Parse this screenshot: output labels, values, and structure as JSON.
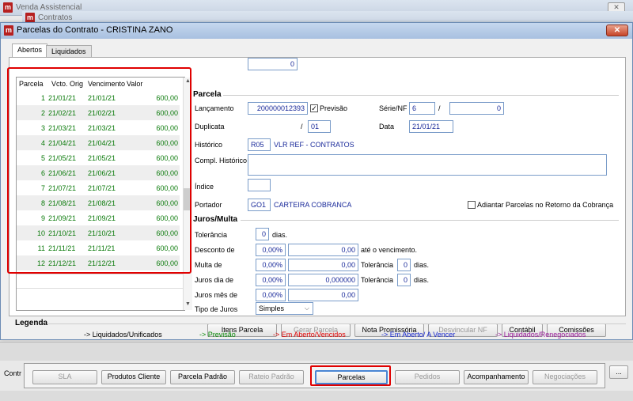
{
  "bg": {
    "title1": "Venda Assistencial",
    "title2": "Contratos",
    "left_label": "Contr"
  },
  "modal": {
    "title": "Parcelas do Contrato - CRISTINA ZANO",
    "close_glyph": "✕"
  },
  "tabs": [
    {
      "label": "Abertos"
    },
    {
      "label": "Liquidados"
    }
  ],
  "grid": {
    "headers": [
      "Parcela",
      "Vcto. Orig",
      "Vencimento",
      "Valor"
    ],
    "rows": [
      [
        "1",
        "21/01/21",
        "21/01/21",
        "600,00"
      ],
      [
        "2",
        "21/02/21",
        "21/02/21",
        "600,00"
      ],
      [
        "3",
        "21/03/21",
        "21/03/21",
        "600,00"
      ],
      [
        "4",
        "21/04/21",
        "21/04/21",
        "600,00"
      ],
      [
        "5",
        "21/05/21",
        "21/05/21",
        "600,00"
      ],
      [
        "6",
        "21/06/21",
        "21/06/21",
        "600,00"
      ],
      [
        "7",
        "21/07/21",
        "21/07/21",
        "600,00"
      ],
      [
        "8",
        "21/08/21",
        "21/08/21",
        "600,00"
      ],
      [
        "9",
        "21/09/21",
        "21/09/21",
        "600,00"
      ],
      [
        "10",
        "21/10/21",
        "21/10/21",
        "600,00"
      ],
      [
        "11",
        "21/11/21",
        "21/11/21",
        "600,00"
      ],
      [
        "12",
        "21/12/21",
        "21/12/21",
        "600,00"
      ]
    ]
  },
  "parcela": {
    "section": "Parcela",
    "lancamento_label": "Lançamento",
    "lancamento": "200000012393",
    "previsao_label": "Previsão",
    "previsao_checked": "✓",
    "serie_label": "Série/NF",
    "serie": "6",
    "serie_sep": "/",
    "nf": "0",
    "duplicata_label": "Duplicata",
    "duplicata": "0",
    "duplicata_sep": "/",
    "duplicata2": "01",
    "data_label": "Data",
    "data": "21/01/21",
    "historico_label": "Histórico",
    "historico_code": "R05",
    "historico_desc": "VLR REF - CONTRATOS",
    "compl_label": "Compl. Histórico",
    "indice_label": "Índice",
    "portador_label": "Portador",
    "portador_code": "GO1",
    "portador_desc": "CARTEIRA COBRANCA",
    "adiantar_label": "Adiantar Parcelas no Retorno da Cobrança"
  },
  "juros": {
    "section": "Juros/Multa",
    "tolerancia_label": "Tolerância",
    "tolerancia": "0",
    "dias": "dias.",
    "desconto_label": "Desconto de",
    "desconto_pct": "0,00%",
    "desconto_val": "0,00",
    "ate_venc": "até o vencimento.",
    "multa_label": "Multa de",
    "multa_pct": "0,00%",
    "multa_val": "0,00",
    "tol2_label": "Tolerância",
    "tol2": "0",
    "jdia_label": "Juros dia de",
    "jdia_pct": "0,00%",
    "jdia_val": "0,000000",
    "tol3_label": "Tolerância",
    "tol3": "0",
    "jmes_label": "Juros mês de",
    "jmes_pct": "0,00%",
    "jmes_val": "0,00",
    "tipo_label": "Tipo de Juros",
    "tipo": "Simples"
  },
  "actions": {
    "itens": "Itens Parcela",
    "gerar": "Gerar Parcela",
    "nota": "Nota Promissória",
    "desvincular": "Desvincular NF",
    "contabil": "Contábil",
    "comissoes": "Comissões"
  },
  "legend": {
    "title": "Legenda",
    "items": [
      {
        "text": "-> Liquidados/Unificados",
        "color": "#000000"
      },
      {
        "text": "-> Previsão",
        "color": "#0a8a0a"
      },
      {
        "text": "-> Em Aberto/Vencidos",
        "color": "#e00000"
      },
      {
        "text": "-> Em Aberto/ A Vencer",
        "color": "#1a2ad0"
      },
      {
        "text": "-> Liquidados/Renegociados",
        "color": "#9a1a9a"
      }
    ]
  },
  "bottom": {
    "sla": "SLA",
    "produtos": "Produtos Cliente",
    "parcela_padrao": "Parcela Padrão",
    "rateio": "Rateio Padrão",
    "parcelas": "Parcelas",
    "pedidos": "Pedidos",
    "acompanhamento": "Acompanhamento",
    "negociacoes": "Negociações",
    "more": "..."
  }
}
